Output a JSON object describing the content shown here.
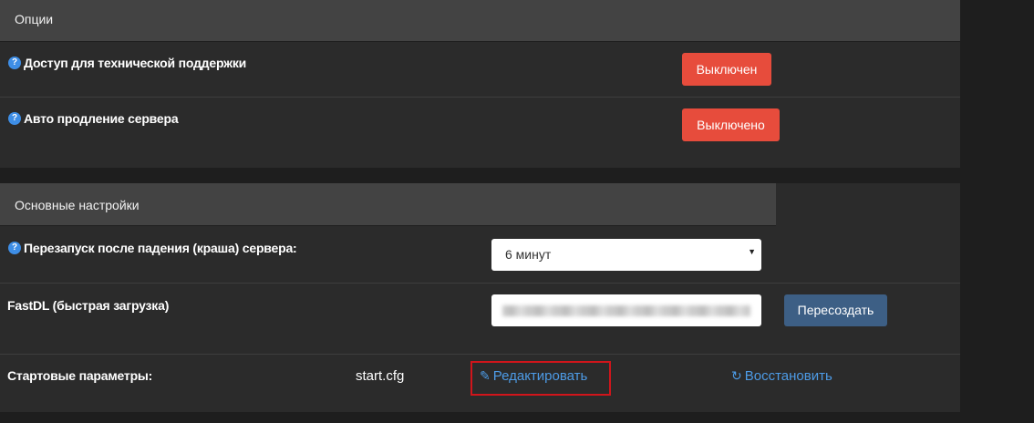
{
  "options": {
    "title": "Опции",
    "support_access": {
      "label": "Доступ для технической поддержки",
      "button": "Выключен"
    },
    "auto_renew": {
      "label": "Авто продление сервера",
      "button": "Выключено"
    }
  },
  "main": {
    "title": "Основные настройки",
    "restart": {
      "label": "Перезапуск после падения (краша) сервера:",
      "selected": "6 минут"
    },
    "fastdl": {
      "label": "FastDL (быстрая загрузка)",
      "button": "Пересоздать"
    },
    "startup": {
      "label": "Стартовые параметры:",
      "file": "start.cfg",
      "edit": "Редактировать",
      "restore": "Восстановить"
    }
  },
  "colors": {
    "red_button": "#e74c3c",
    "blue_button": "#3d5f85",
    "link": "#4d9be6",
    "highlight": "#d0151b"
  },
  "icons": {
    "help": "help-icon",
    "edit": "pencil-icon",
    "restore": "refresh-icon",
    "select": "caret-down-icon"
  }
}
